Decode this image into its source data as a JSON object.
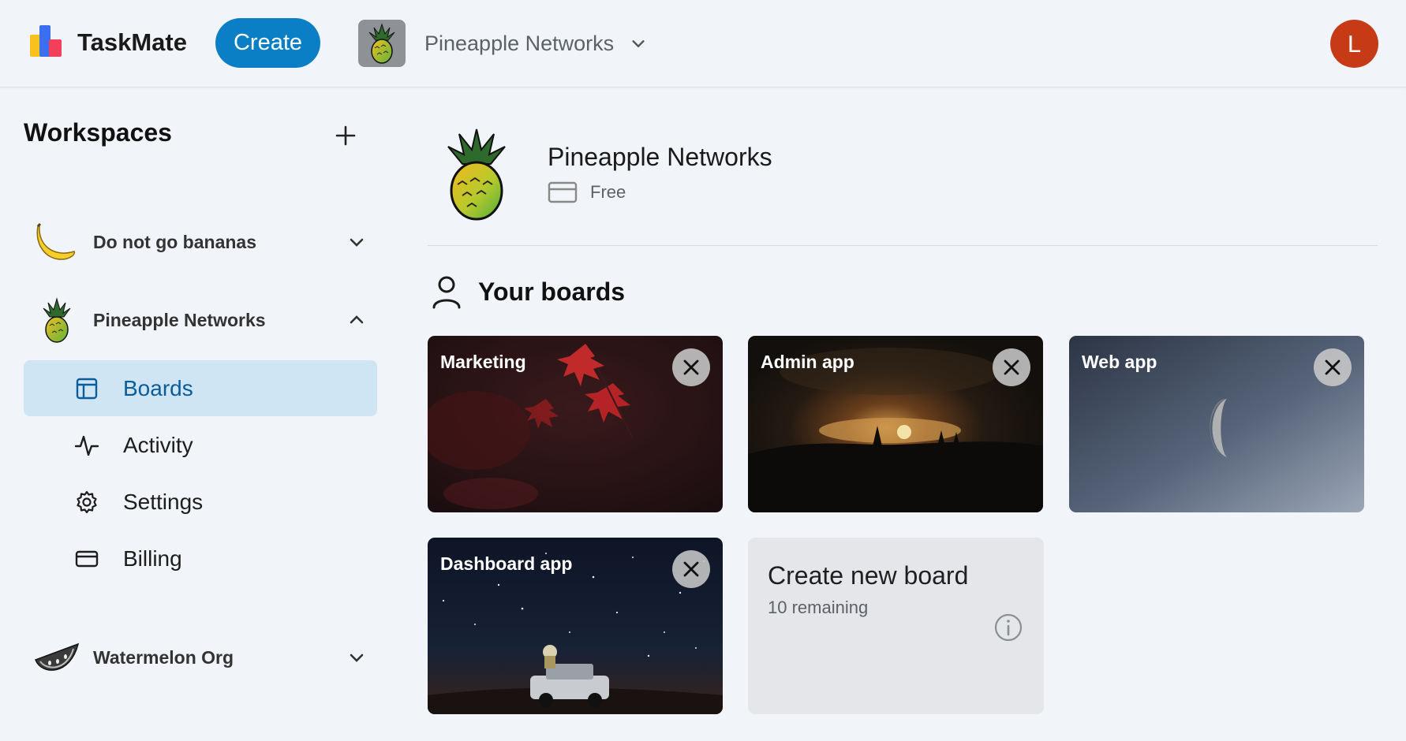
{
  "header": {
    "brand": "TaskMate",
    "create_label": "Create",
    "workspace_name": "Pineapple Networks",
    "avatar_letter": "L"
  },
  "sidebar": {
    "title": "Workspaces",
    "workspaces": [
      {
        "name": "Do not go bananas",
        "icon": "banana-icon",
        "expanded": false
      },
      {
        "name": "Pineapple Networks",
        "icon": "pineapple-icon",
        "expanded": true
      },
      {
        "name": "Watermelon Org",
        "icon": "watermelon-icon",
        "expanded": false
      }
    ],
    "nav": [
      {
        "label": "Boards",
        "icon": "boards-icon",
        "active": true
      },
      {
        "label": "Activity",
        "icon": "activity-icon",
        "active": false
      },
      {
        "label": "Settings",
        "icon": "settings-icon",
        "active": false
      },
      {
        "label": "Billing",
        "icon": "billing-icon",
        "active": false
      }
    ]
  },
  "main": {
    "workspace_title": "Pineapple Networks",
    "plan": "Free",
    "section_title": "Your boards",
    "boards": [
      {
        "name": "Marketing",
        "background": "red-leaves"
      },
      {
        "name": "Admin app",
        "background": "sunset-forest"
      },
      {
        "name": "Web app",
        "background": "moon-sky"
      },
      {
        "name": "Dashboard app",
        "background": "starry-night-jeep"
      }
    ],
    "create_board": {
      "title": "Create new board",
      "remaining": "10 remaining"
    }
  },
  "colors": {
    "accent": "#0a7fc5",
    "avatar": "#c63a16",
    "active_nav_bg": "#cfe5f4",
    "page_bg": "#f1f4f9"
  }
}
